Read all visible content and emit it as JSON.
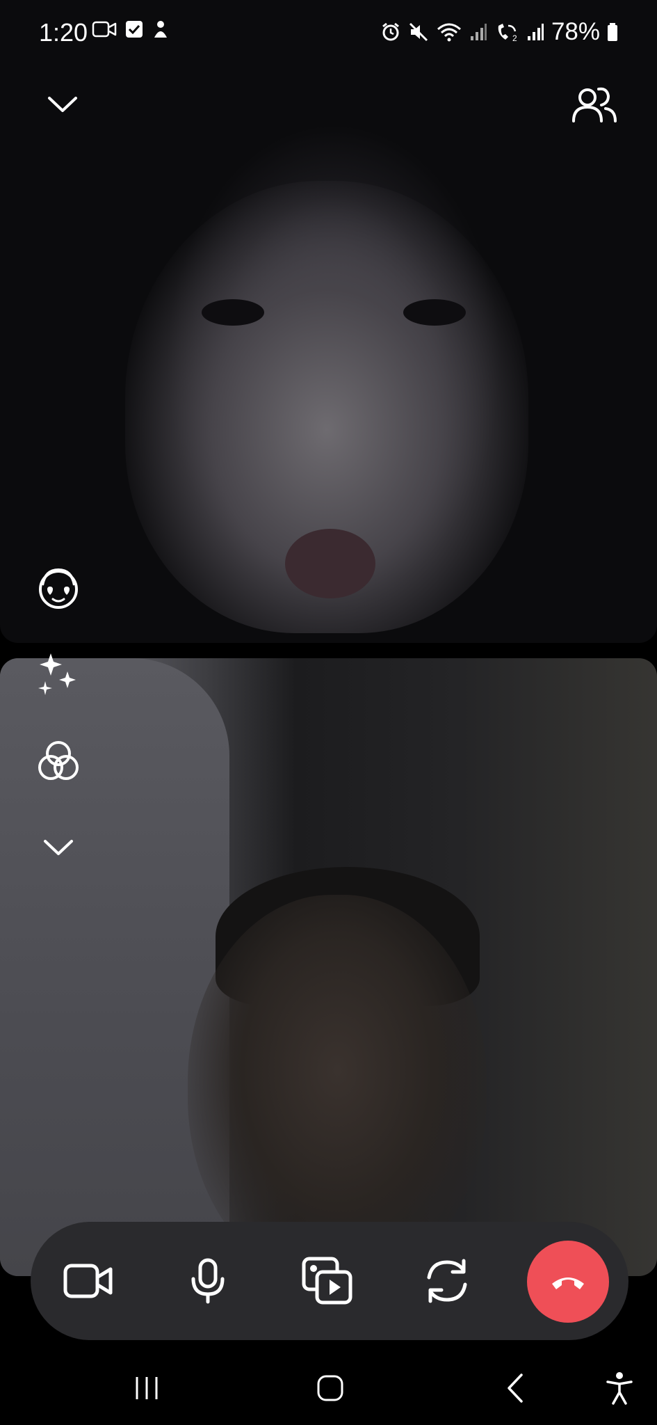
{
  "status_bar": {
    "time": "1:20",
    "battery": "78%",
    "left_icons": [
      "video-camera-icon",
      "checkbox-icon",
      "person-icon"
    ],
    "right_icons": [
      "alarm-icon",
      "mute-icon",
      "wifi-icon",
      "signal-icon",
      "wifi-calling-icon",
      "signal-icon",
      "battery-icon"
    ]
  },
  "top_controls": {
    "collapse_icon": "chevron-down-icon",
    "participants_icon": "participants-icon"
  },
  "effects_menu": {
    "items": [
      "face-filter-icon",
      "sparkles-effects-icon",
      "color-filter-icon",
      "chevron-down-icon"
    ]
  },
  "call_controls": {
    "items": [
      "video-camera-icon",
      "microphone-icon",
      "media-share-icon",
      "switch-camera-icon",
      "end-call-icon"
    ],
    "end_call_color": "#ef4f57",
    "bar_color": "#2a2a2d"
  },
  "nav_bar": {
    "items": [
      "recent-apps-icon",
      "home-icon",
      "back-icon",
      "accessibility-icon"
    ]
  }
}
